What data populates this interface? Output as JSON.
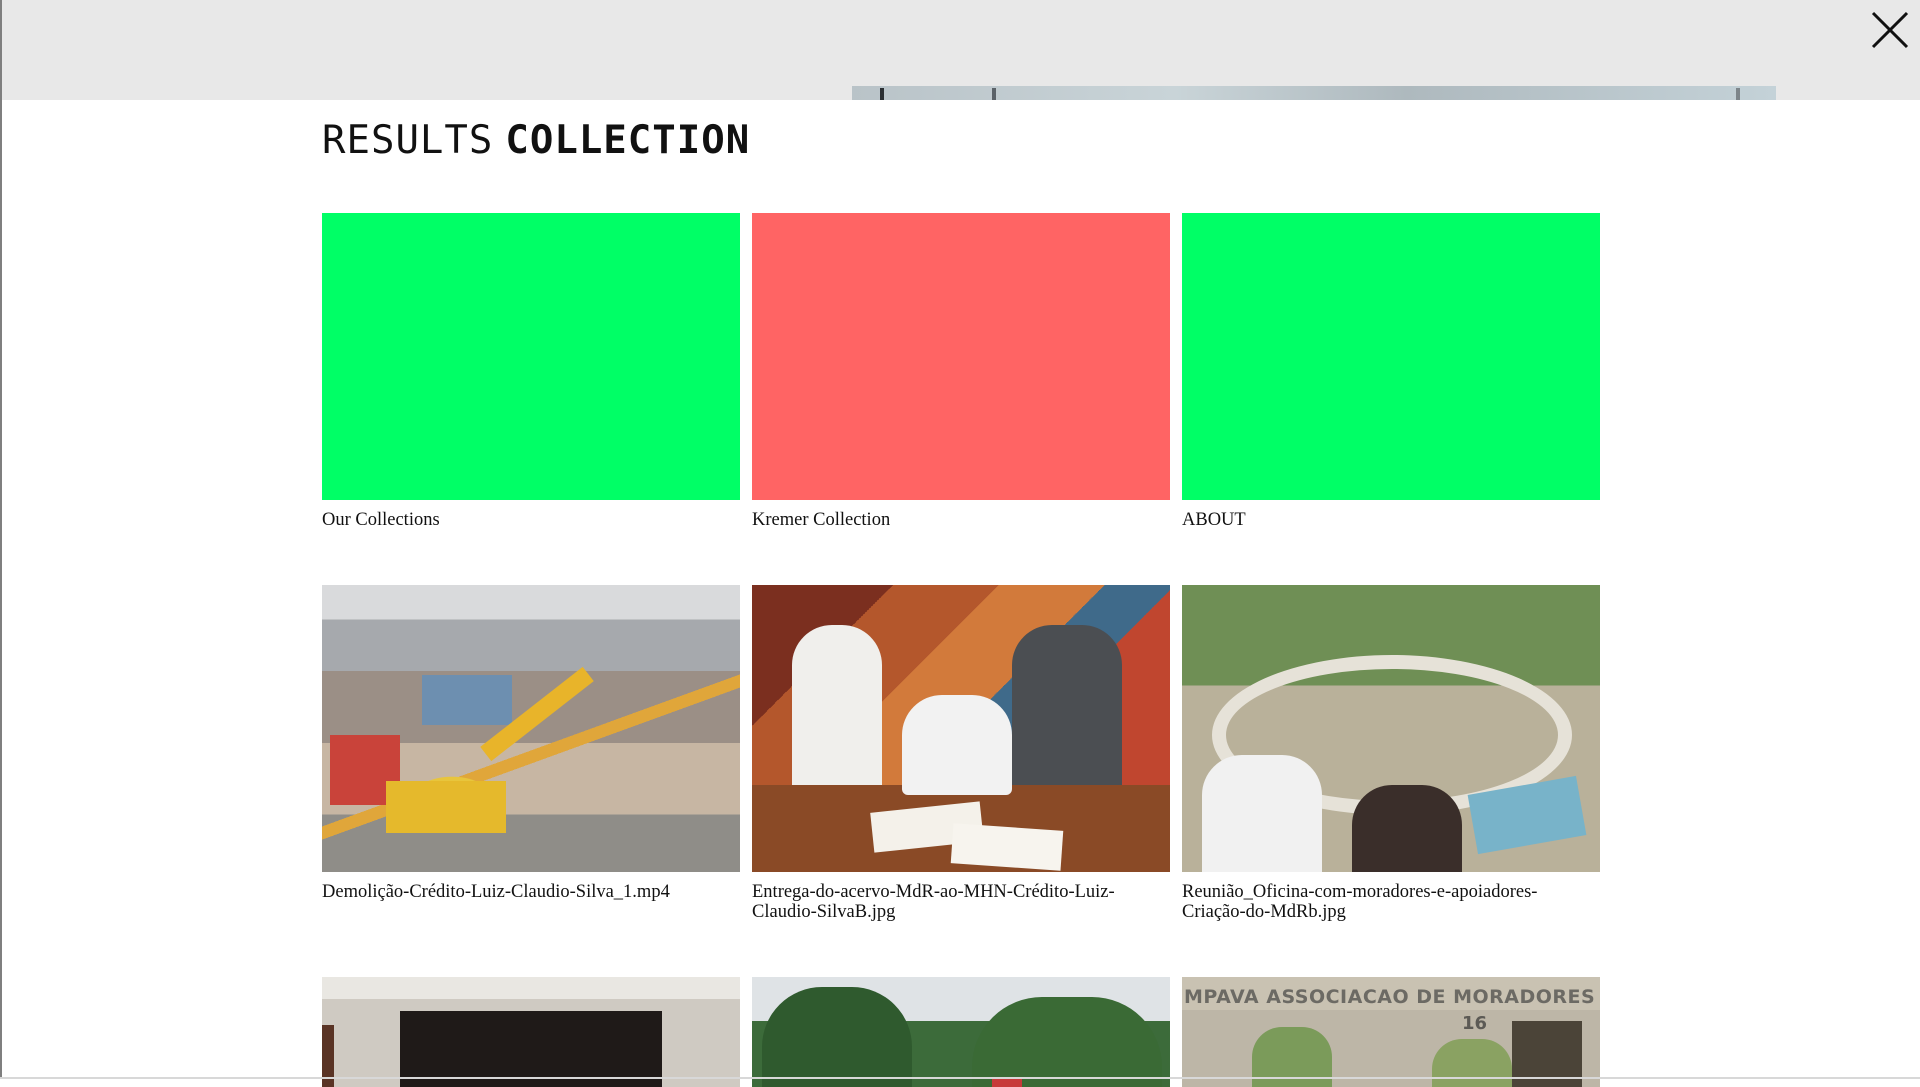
{
  "header": {
    "close_icon": "close-icon"
  },
  "page": {
    "title_light": "RESULTS",
    "title_bold": "COLLECTION"
  },
  "colors": {
    "green": "#00ff66",
    "red": "#ff6464",
    "top_strip": "#e8e8e8"
  },
  "cards": [
    {
      "label": "Our Collections",
      "tile_color": "green"
    },
    {
      "label": "Kremer Collection",
      "tile_color": "red"
    },
    {
      "label": "ABOUT",
      "tile_color": "green"
    },
    {
      "label": "Demolição-Crédito-Luiz-Claudio-Silva_1.mp4",
      "image": "demolition-photo"
    },
    {
      "label": "Entrega-do-acervo-MdR-ao-MHN-Crédito-Luiz-Claudio-SilvaB.jpg",
      "image": "signing-photo"
    },
    {
      "label": "Reunião_Oficina-com-moradores-e-apoiadores-Criação-do-MdRb.jpg",
      "image": "meeting-photo"
    },
    {
      "label": "",
      "image": "room-photo"
    },
    {
      "label": "",
      "image": "trees-photo"
    },
    {
      "label": "",
      "image": "association-photo",
      "sign_text": "MPAVA ASSOCIACAO DE MORADORES",
      "sign_number": "16"
    }
  ]
}
